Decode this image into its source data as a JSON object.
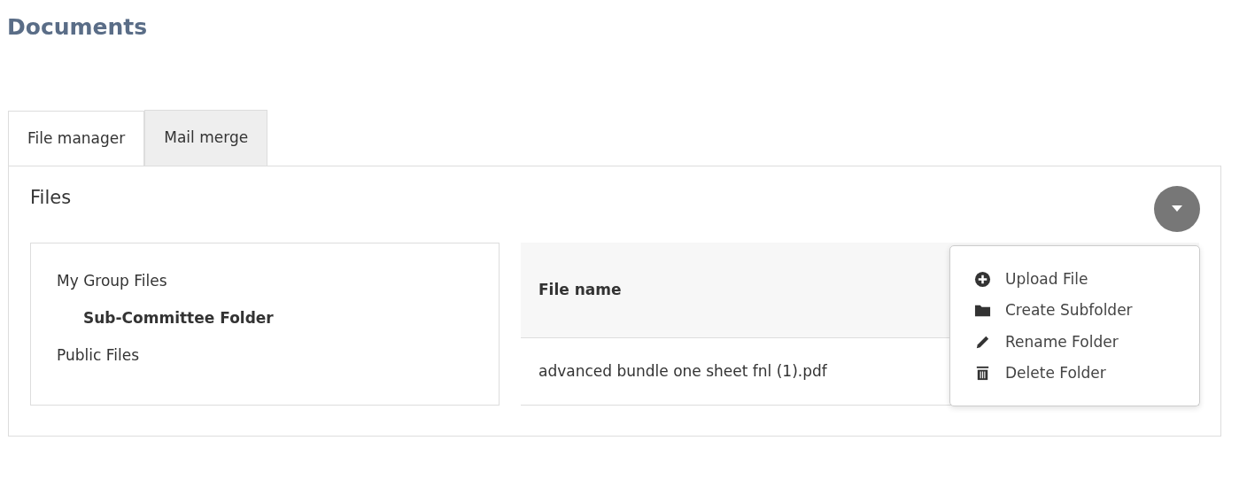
{
  "page_title": "Documents",
  "tabs": [
    {
      "label": "File manager",
      "selected": true
    },
    {
      "label": "Mail merge",
      "selected": false
    }
  ],
  "panel_title": "Files",
  "menu": {
    "expanded": true,
    "items": [
      {
        "kind": "upload",
        "label": "Upload File"
      },
      {
        "kind": "folder",
        "label": "Create Subfolder"
      },
      {
        "kind": "rename",
        "label": "Rename Folder"
      },
      {
        "kind": "delete",
        "label": "Delete Folder"
      }
    ]
  },
  "folders": [
    {
      "label": "My Group Files",
      "selected": false,
      "children": [
        {
          "label": "Sub-Committee Folder",
          "selected": true
        }
      ]
    },
    {
      "label": "Public Files",
      "selected": false
    }
  ],
  "table": {
    "columns": [
      "File name"
    ],
    "rows": [
      [
        "advanced bundle one sheet fnl (1).pdf"
      ]
    ]
  }
}
